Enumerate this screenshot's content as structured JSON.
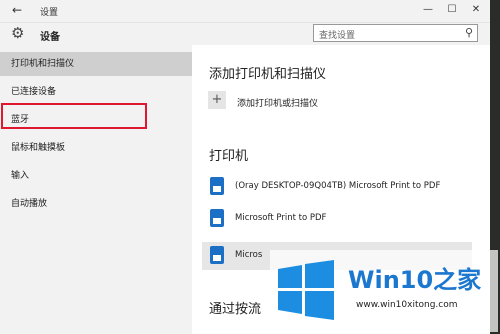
{
  "window": {
    "title": "设置"
  },
  "header": {
    "title": "设备",
    "search_placeholder": "查找设置"
  },
  "sidebar": {
    "items": [
      {
        "label": "打印机和扫描仪"
      },
      {
        "label": "已连接设备"
      },
      {
        "label": "蓝牙"
      },
      {
        "label": "鼠标和触摸板"
      },
      {
        "label": "输入"
      },
      {
        "label": "自动播放"
      }
    ]
  },
  "main": {
    "section_add_title": "添加打印机和扫描仪",
    "add_label": "添加打印机或扫描仪",
    "section_printers_title": "打印机",
    "printers": [
      {
        "label": "(Oray DESKTOP-09Q04TB) Microsoft Print to PDF"
      },
      {
        "label": "Microsoft Print to PDF"
      },
      {
        "label": "Micros"
      }
    ],
    "section_metered_title": "通过按流"
  },
  "watermark": {
    "brand": "Win10之家",
    "url": "www.win10xitong.com"
  },
  "colors": {
    "accent": "#1b6fc4",
    "highlight": "#e0172f",
    "selected": "#cfcfcf"
  },
  "icons": {
    "back": "back-arrow-icon",
    "gear": "gear-icon",
    "search": "search-icon",
    "plus": "plus-icon",
    "printer": "printer-icon"
  }
}
